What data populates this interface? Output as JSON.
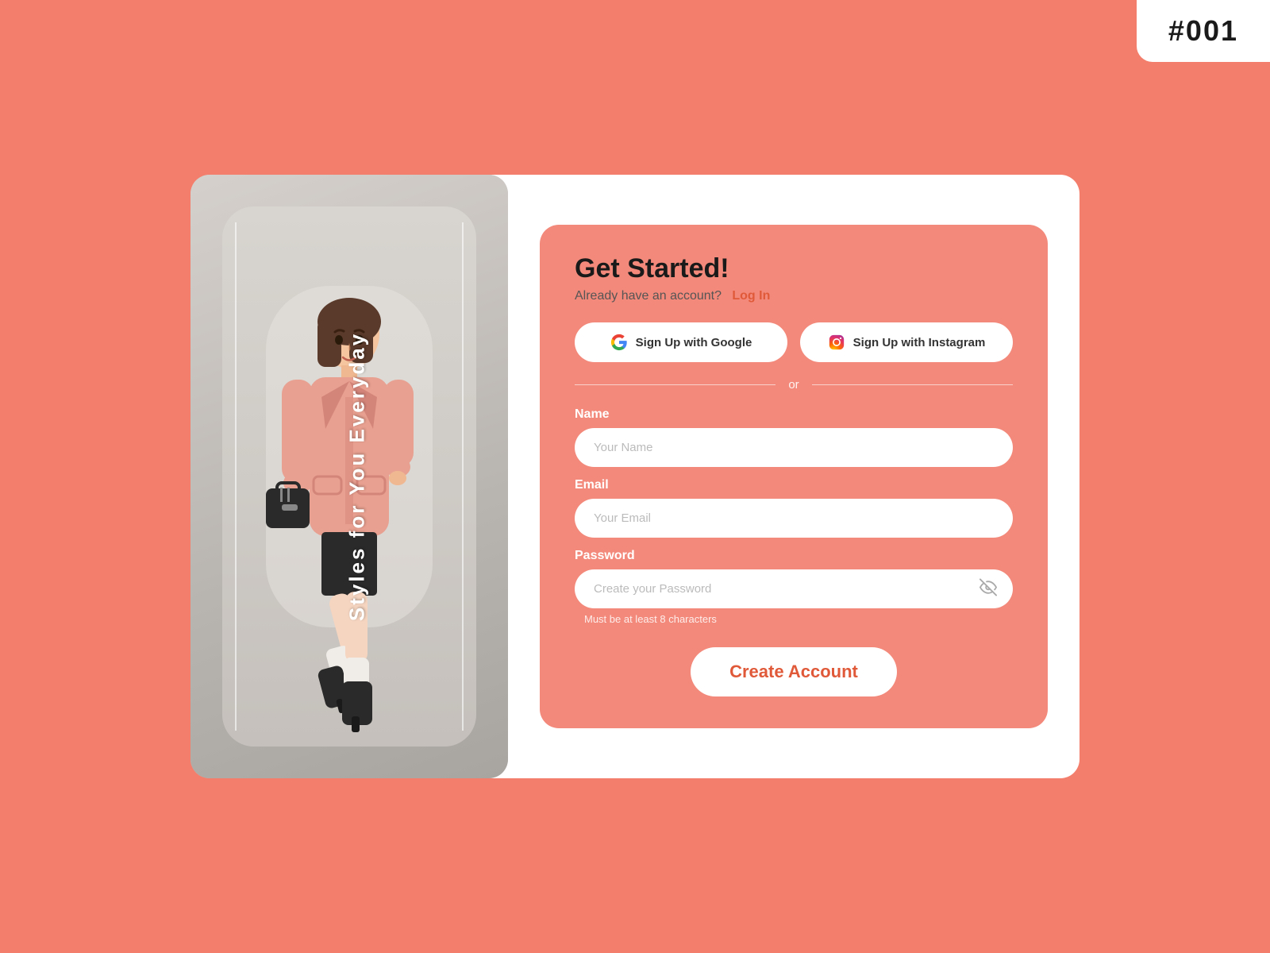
{
  "badge": {
    "text": "#001"
  },
  "left_panel": {
    "tagline": "Styles for You Everyday"
  },
  "form": {
    "title": "Get Started!",
    "subtitle_static": "Already have an account?",
    "login_link": "Log In",
    "google_btn": "Sign Up with Google",
    "instagram_btn": "Sign Up with Instagram",
    "divider_text": "or",
    "name_label": "Name",
    "name_placeholder": "Your Name",
    "email_label": "Email",
    "email_placeholder": "Your Email",
    "password_label": "Password",
    "password_placeholder": "Create your Password",
    "password_hint": "Must be at least 8 characters",
    "create_btn": "Create Account"
  }
}
